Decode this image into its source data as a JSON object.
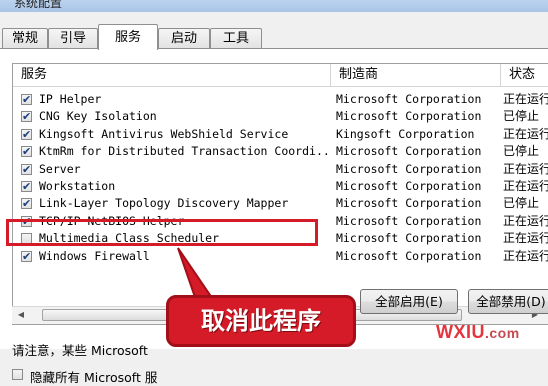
{
  "window": {
    "title": "系统配置"
  },
  "tabs": [
    {
      "label": "常规"
    },
    {
      "label": "引导"
    },
    {
      "label": "服务"
    },
    {
      "label": "启动"
    },
    {
      "label": "工具"
    }
  ],
  "list": {
    "columns": [
      "服务",
      "制造商",
      "状态"
    ],
    "rows": [
      {
        "name": "IP Helper",
        "vendor": "Microsoft Corporation",
        "status": "正在运行",
        "checked": true
      },
      {
        "name": "CNG Key Isolation",
        "vendor": "Microsoft Corporation",
        "status": "已停止",
        "checked": true
      },
      {
        "name": "Kingsoft Antivirus WebShield Service",
        "vendor": "Kingsoft Corporation",
        "status": "正在运行",
        "checked": true
      },
      {
        "name": "KtmRm for Distributed Transaction Coordi...",
        "vendor": "Microsoft Corporation",
        "status": "已停止",
        "checked": true
      },
      {
        "name": "Server",
        "vendor": "Microsoft Corporation",
        "status": "正在运行",
        "checked": true
      },
      {
        "name": "Workstation",
        "vendor": "Microsoft Corporation",
        "status": "正在运行",
        "checked": true
      },
      {
        "name": "Link-Layer Topology Discovery Mapper",
        "vendor": "Microsoft Corporation",
        "status": "已停止",
        "checked": true
      },
      {
        "name": "TCP/IP NetBIOS Helper",
        "vendor": "Microsoft Corporation",
        "status": "正在运行",
        "checked": true
      },
      {
        "name": "Multimedia Class Scheduler",
        "vendor": "Microsoft Corporation",
        "status": "正在运行",
        "checked": false
      },
      {
        "name": "Windows Firewall",
        "vendor": "Microsoft Corporation",
        "status": "正在运行",
        "checked": true
      }
    ],
    "scroll_thumb_label": "|||"
  },
  "note": "请注意，某些 Microsoft",
  "hide_ms_label": "隐藏所有 Microsoft 服",
  "buttons": {
    "enable_all": "全部启用(E)",
    "disable_all": "全部禁用(D)"
  },
  "annotation": {
    "callout_text": "取消此程序",
    "color": "#d51b27"
  },
  "watermark": {
    "text": "WXIU",
    "suffix": ".com"
  }
}
